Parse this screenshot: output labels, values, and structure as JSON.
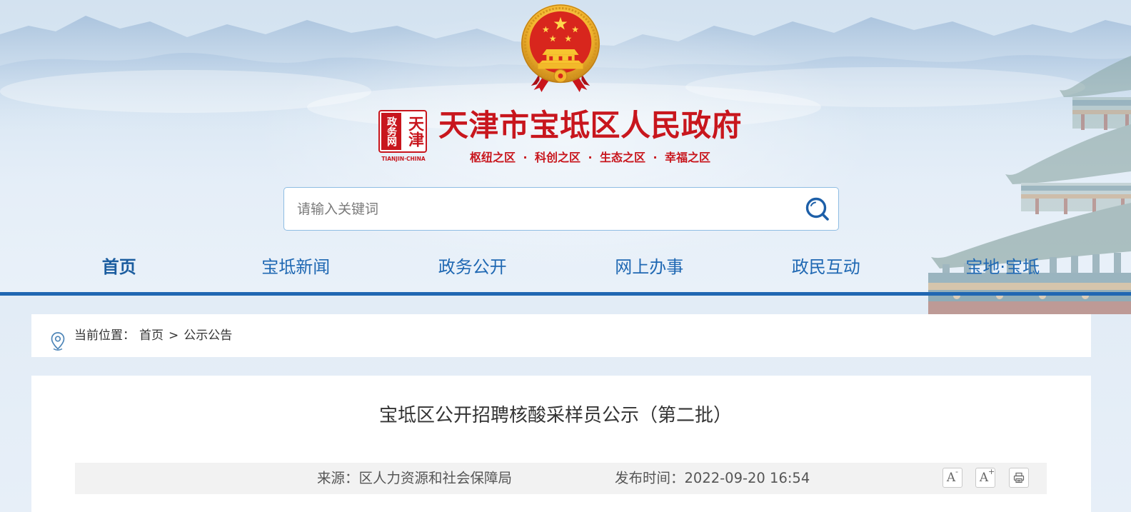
{
  "site": {
    "title": "天津市宝坻区人民政府",
    "slogan": {
      "items": [
        "枢纽之区",
        "科创之区",
        "生态之区",
        "幸福之区"
      ],
      "separator": "·"
    },
    "seal": {
      "left": "政务网",
      "right": "天津",
      "caption": "TIANJIN·CHINA"
    },
    "emblem": "national-emblem-icon"
  },
  "search": {
    "placeholder": "请输入关键词",
    "value": "",
    "button_icon": "search-icon"
  },
  "nav": {
    "items": [
      {
        "label": "首页",
        "active": true
      },
      {
        "label": "宝坻新闻",
        "active": false
      },
      {
        "label": "政务公开",
        "active": false
      },
      {
        "label": "网上办事",
        "active": false
      },
      {
        "label": "政民互动",
        "active": false
      },
      {
        "label": "宝地·宝坻",
        "active": false
      }
    ]
  },
  "breadcrumb": {
    "icon": "location-pin-icon",
    "prefix": "当前位置：",
    "items": [
      "首页",
      "公示公告"
    ],
    "separator": ">"
  },
  "article": {
    "title": "宝坻区公开招聘核酸采样员公示（第二批）",
    "source_label": "来源：",
    "source": "区人力资源和社会保障局",
    "date_label": "发布时间：",
    "date": "2022-09-20 16:54",
    "tools": [
      {
        "icon": "font-decrease-icon",
        "glyph": "A",
        "mark": "-"
      },
      {
        "icon": "font-increase-icon",
        "glyph": "A",
        "mark": "+"
      },
      {
        "icon": "print-icon"
      }
    ]
  },
  "colors": {
    "brand_red": "#c8161d",
    "nav_blue": "#1f68b3",
    "nav_active": "#1a5c9f",
    "divider_blue": "#2067b2",
    "page_bg": "#e6eff8",
    "panel_bg": "#ffffff",
    "meta_bar_bg": "#f2f2f2"
  }
}
